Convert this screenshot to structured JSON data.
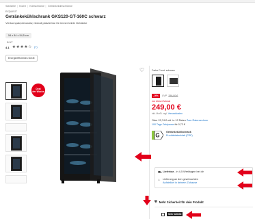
{
  "breadcrumb": [
    "Startseite",
    "Küche",
    "Kühlschränke",
    "Getränkekühlschränke"
  ],
  "product": {
    "brand": "EXQUISIT",
    "title": "Getränkekühlschrank GKS120-GT-160C schwarz",
    "subtitle": "Vierkompakt,dekorativ, überall platzierbar für immer kühle Getränke",
    "dimensions": "54 x 84 x 54,5 cm",
    "dimensions_sub": "B/H/T",
    "rating_score": "4.1",
    "rating_stars": "★★★★☆",
    "rating_count": "(7)",
    "energy_chip": "Energieeffizientes Gerät",
    "deal_badge_line1": "Deal",
    "deal_badge_line2": "der Woche"
  },
  "colors": {
    "accent": "#e2001a",
    "link": "#1a73c9",
    "energy_green": "#8dc63f"
  },
  "icons": {
    "heart": "heart-icon",
    "truck": "truck-icon",
    "home": "home-delivery-icon",
    "shield": "shield-icon"
  },
  "buy": {
    "color_label": "Farbe Front: schwarz",
    "discount": "-16%",
    "uvp_label": "UVP",
    "uvp_old": "299,00 €",
    "new_price_label": "nur dieser Monat",
    "price": "249,00 €",
    "vat": "inkl. MwSt. zzgl.",
    "vat_link": "Versandkosten",
    "financing_text": "Oder 22,74 € mtl. in 12 Raten",
    "financing_link": "Zum Ratenrechner",
    "financing_sub": "100 Tage Zahlpause",
    "financing_sub2": "für 0,72 €",
    "energy_title": "Getränkekühlschrank",
    "energy_link": "Produktdatenblatt (PDF)",
    "energy_class": "G"
  },
  "shipping": {
    "row1_prefix": "Lieferbar",
    "row1": " - in 4-5 Werktagen bei dir",
    "row2": "Lieferung an den gewünschten",
    "row2_link": "Aufstellort in deinem Zuhause"
  },
  "more_security": "Mehr Sicherheit für dein Produkt",
  "secondhand_label": "Sehr beliebt"
}
